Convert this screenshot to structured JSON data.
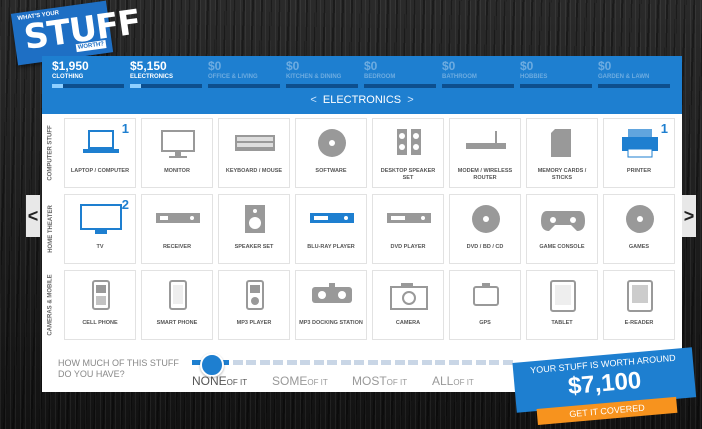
{
  "logo": {
    "top": "WHAT'S YOUR",
    "big": "STUFF",
    "worth": "WORTH?"
  },
  "categories": [
    {
      "amount": "$1,950",
      "name": "CLOTHING",
      "active": true,
      "fill": 0.15
    },
    {
      "amount": "$5,150",
      "name": "ELECTRONICS",
      "active": true,
      "fill": 0.15
    },
    {
      "amount": "$0",
      "name": "OFFICE & LIVING",
      "active": false,
      "fill": 0
    },
    {
      "amount": "$0",
      "name": "KITCHEN & DINING",
      "active": false,
      "fill": 0
    },
    {
      "amount": "$0",
      "name": "BEDROOM",
      "active": false,
      "fill": 0
    },
    {
      "amount": "$0",
      "name": "BATHROOM",
      "active": false,
      "fill": 0
    },
    {
      "amount": "$0",
      "name": "HOBBIES",
      "active": false,
      "fill": 0
    },
    {
      "amount": "$0",
      "name": "GARDEN & LAWN",
      "active": false,
      "fill": 0
    }
  ],
  "subnav": {
    "prev": "<",
    "label": "ELECTRONICS",
    "next": ">"
  },
  "rows": [
    {
      "label": "COMPUTER STUFF",
      "items": [
        {
          "label": "LAPTOP / COMPUTER",
          "icon": "laptop-icon",
          "count": "1"
        },
        {
          "label": "MONITOR",
          "icon": "monitor-icon",
          "count": ""
        },
        {
          "label": "KEYBOARD / MOUSE",
          "icon": "keyboard-icon",
          "count": ""
        },
        {
          "label": "SOFTWARE",
          "icon": "disc-icon",
          "count": ""
        },
        {
          "label": "DESKTOP SPEAKER SET",
          "icon": "speakers-icon",
          "count": ""
        },
        {
          "label": "MODEM / WIRELESS ROUTER",
          "icon": "router-icon",
          "count": ""
        },
        {
          "label": "MEMORY CARDS / STICKS",
          "icon": "memory-card-icon",
          "count": ""
        },
        {
          "label": "PRINTER",
          "icon": "printer-icon",
          "count": "1"
        }
      ]
    },
    {
      "label": "HOME THEATER",
      "items": [
        {
          "label": "TV",
          "icon": "tv-icon",
          "count": "2"
        },
        {
          "label": "RECEIVER",
          "icon": "receiver-icon",
          "count": ""
        },
        {
          "label": "SPEAKER SET",
          "icon": "speaker-icon",
          "count": ""
        },
        {
          "label": "BLU-RAY PLAYER",
          "icon": "bluray-player-icon",
          "count": ""
        },
        {
          "label": "DVD PLAYER",
          "icon": "dvd-player-icon",
          "count": ""
        },
        {
          "label": "DVD / BD / CD",
          "icon": "disc-icon",
          "count": ""
        },
        {
          "label": "GAME CONSOLE",
          "icon": "game-controller-icon",
          "count": ""
        },
        {
          "label": "GAMES",
          "icon": "disc-icon",
          "count": ""
        }
      ]
    },
    {
      "label": "CAMERAS & MOBILE",
      "items": [
        {
          "label": "CELL PHONE",
          "icon": "cell-phone-icon",
          "count": ""
        },
        {
          "label": "SMART PHONE",
          "icon": "smart-phone-icon",
          "count": ""
        },
        {
          "label": "MP3 PLAYER",
          "icon": "mp3-player-icon",
          "count": ""
        },
        {
          "label": "MP3 DOCKING STATION",
          "icon": "docking-station-icon",
          "count": ""
        },
        {
          "label": "CAMERA",
          "icon": "camera-icon",
          "count": ""
        },
        {
          "label": "GPS",
          "icon": "gps-icon",
          "count": ""
        },
        {
          "label": "TABLET",
          "icon": "tablet-icon",
          "count": ""
        },
        {
          "label": "E-READER",
          "icon": "ereader-icon",
          "count": ""
        }
      ]
    }
  ],
  "bottom": {
    "question": "HOW MUCH OF THIS STUFF DO YOU HAVE?",
    "options": [
      {
        "big": "NONE",
        "small": "OF IT",
        "selected": true
      },
      {
        "big": "SOME",
        "small": "OF IT",
        "selected": false
      },
      {
        "big": "MOST",
        "small": "OF IT",
        "selected": false
      },
      {
        "big": "ALL",
        "small": "OF IT",
        "selected": false
      }
    ],
    "slider_level": 0
  },
  "total": {
    "title": "YOUR STUFF IS WORTH AROUND",
    "amount": "$7,100",
    "button": "GET IT COVERED"
  },
  "nav": {
    "left": "<",
    "right": ">"
  },
  "colors": {
    "accent": "#1e7fd0",
    "orange": "#f7931e",
    "icon_gray": "#999999"
  }
}
